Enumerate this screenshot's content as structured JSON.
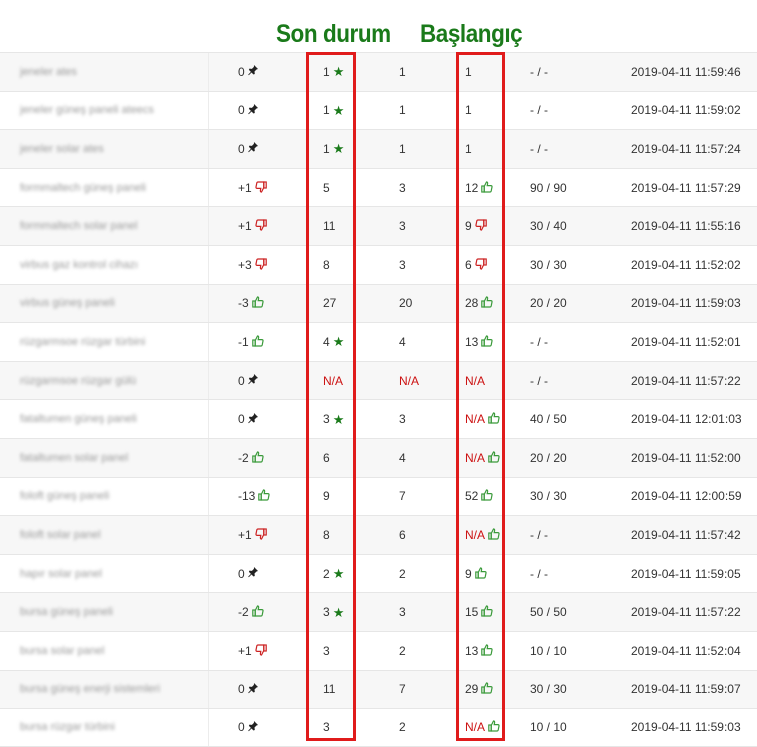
{
  "annotations": {
    "son_durum": "Son durum",
    "baslangic": "Başlangıç"
  },
  "colors": {
    "annotation_green": "#1a7a1a",
    "highlight_red": "#e01b1b",
    "na_red": "#cc1111",
    "up_green": "#3a9a3a",
    "down_red": "#cc2222"
  },
  "rows": [
    {
      "keyword": "jeneler ates",
      "change": "0",
      "change_icon": "pin-icon",
      "current": "1",
      "current_icon": "star-icon",
      "previous": "1",
      "start": "1",
      "start_icon": "",
      "target": "- / -",
      "date": "2019-04-11 11:59:46"
    },
    {
      "keyword": "jeneler güneş paneli ateecs",
      "change": "0",
      "change_icon": "pin-icon",
      "current": "1",
      "current_icon": "star-icon",
      "previous": "1",
      "start": "1",
      "start_icon": "",
      "target": "- / -",
      "date": "2019-04-11 11:59:02"
    },
    {
      "keyword": "jeneler solar ates",
      "change": "0",
      "change_icon": "pin-icon",
      "current": "1",
      "current_icon": "star-icon",
      "previous": "1",
      "start": "1",
      "start_icon": "",
      "target": "- / -",
      "date": "2019-04-11 11:57:24"
    },
    {
      "keyword": "formmaltech güneş paneli",
      "change": "+1",
      "change_icon": "thumb-down-icon",
      "current": "5",
      "current_icon": "",
      "previous": "3",
      "start": "12",
      "start_icon": "thumb-up-icon",
      "target": "90 / 90",
      "date": "2019-04-11 11:57:29"
    },
    {
      "keyword": "formmaltech solar panel",
      "change": "+1",
      "change_icon": "thumb-down-icon",
      "current": "11",
      "current_icon": "",
      "previous": "3",
      "start": "9",
      "start_icon": "thumb-down-icon",
      "target": "30 / 40",
      "date": "2019-04-11 11:55:16"
    },
    {
      "keyword": "virbus gaz kontrol cihazı",
      "change": "+3",
      "change_icon": "thumb-down-icon",
      "current": "8",
      "current_icon": "",
      "previous": "3",
      "start": "6",
      "start_icon": "thumb-down-icon",
      "target": "30 / 30",
      "date": "2019-04-11 11:52:02"
    },
    {
      "keyword": "virbus güneş paneli",
      "change": "-3",
      "change_icon": "thumb-up-icon",
      "current": "27",
      "current_icon": "",
      "previous": "20",
      "start": "28",
      "start_icon": "thumb-up-icon",
      "target": "20 / 20",
      "date": "2019-04-11 11:59:03"
    },
    {
      "keyword": "rüzgarmsoe rüzgar türbini",
      "change": "-1",
      "change_icon": "thumb-up-icon",
      "current": "4",
      "current_icon": "star-icon",
      "previous": "4",
      "start": "13",
      "start_icon": "thumb-up-icon",
      "target": "- / -",
      "date": "2019-04-11 11:52:01"
    },
    {
      "keyword": "rüzgarmsoe rüzgar gülü",
      "change": "0",
      "change_icon": "pin-icon",
      "current": "N/A",
      "current_icon": "",
      "previous": "N/A",
      "start": "N/A",
      "start_icon": "",
      "target": "- / -",
      "date": "2019-04-11 11:57:22"
    },
    {
      "keyword": "fataltumen güneş paneli",
      "change": "0",
      "change_icon": "pin-icon",
      "current": "3",
      "current_icon": "star-icon",
      "previous": "3",
      "start": "N/A",
      "start_icon": "thumb-up-icon",
      "target": "40 / 50",
      "date": "2019-04-11 12:01:03"
    },
    {
      "keyword": "fataltumen solar panel",
      "change": "-2",
      "change_icon": "thumb-up-icon",
      "current": "6",
      "current_icon": "",
      "previous": "4",
      "start": "N/A",
      "start_icon": "thumb-up-icon",
      "target": "20 / 20",
      "date": "2019-04-11 11:52:00"
    },
    {
      "keyword": "foloft güneş paneli",
      "change": "-13",
      "change_icon": "thumb-up-icon",
      "current": "9",
      "current_icon": "",
      "previous": "7",
      "start": "52",
      "start_icon": "thumb-up-icon",
      "target": "30 / 30",
      "date": "2019-04-11 12:00:59"
    },
    {
      "keyword": "foloft solar panel",
      "change": "+1",
      "change_icon": "thumb-down-icon",
      "current": "8",
      "current_icon": "",
      "previous": "6",
      "start": "N/A",
      "start_icon": "thumb-up-icon",
      "target": "- / -",
      "date": "2019-04-11 11:57:42"
    },
    {
      "keyword": "hapır solar panel",
      "change": "0",
      "change_icon": "pin-icon",
      "current": "2",
      "current_icon": "star-icon",
      "previous": "2",
      "start": "9",
      "start_icon": "thumb-up-icon",
      "target": "- / -",
      "date": "2019-04-11 11:59:05"
    },
    {
      "keyword": "bursa güneş paneli",
      "change": "-2",
      "change_icon": "thumb-up-icon",
      "current": "3",
      "current_icon": "star-icon",
      "previous": "3",
      "start": "15",
      "start_icon": "thumb-up-icon",
      "target": "50 / 50",
      "date": "2019-04-11 11:57:22"
    },
    {
      "keyword": "bursa solar panel",
      "change": "+1",
      "change_icon": "thumb-down-icon",
      "current": "3",
      "current_icon": "",
      "previous": "2",
      "start": "13",
      "start_icon": "thumb-up-icon",
      "target": "10 / 10",
      "date": "2019-04-11 11:52:04"
    },
    {
      "keyword": "bursa güneş enerji sistemleri",
      "change": "0",
      "change_icon": "pin-icon",
      "current": "11",
      "current_icon": "",
      "previous": "7",
      "start": "29",
      "start_icon": "thumb-up-icon",
      "target": "30 / 30",
      "date": "2019-04-11 11:59:07"
    },
    {
      "keyword": "bursa rüzgar türbini",
      "change": "0",
      "change_icon": "pin-icon",
      "current": "3",
      "current_icon": "",
      "previous": "2",
      "start": "N/A",
      "start_icon": "thumb-up-icon",
      "target": "10 / 10",
      "date": "2019-04-11 11:59:03"
    }
  ]
}
